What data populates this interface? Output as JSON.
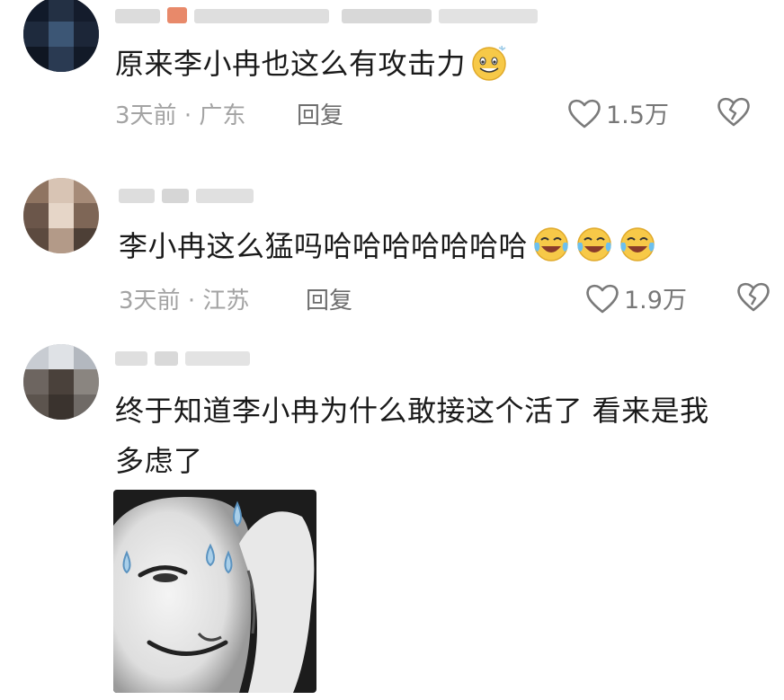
{
  "colors": {
    "text": "#1a1a1a",
    "meta": "#a3a3a3",
    "reply": "#6e6e6e",
    "icon": "#7a7a7a"
  },
  "comments": [
    {
      "text": "原来李小冉也这么有攻击力",
      "emojis": [
        "grin-sweat-emoji"
      ],
      "time": "3天前",
      "location": "广东",
      "reply_label": "回复",
      "likes": "1.5万"
    },
    {
      "text": "李小冉这么猛吗哈哈哈哈哈哈哈",
      "emojis": [
        "laugh-cry-emoji",
        "laugh-cry-emoji",
        "laugh-cry-emoji"
      ],
      "time": "3天前",
      "location": "江苏",
      "reply_label": "回复",
      "likes": "1.9万"
    },
    {
      "text_line1": "终于知道李小冉为什么敢接这个活了 看来是我",
      "text_line2": "多虑了",
      "sticker": "sweating-face-sticker"
    }
  ],
  "separator": "·"
}
